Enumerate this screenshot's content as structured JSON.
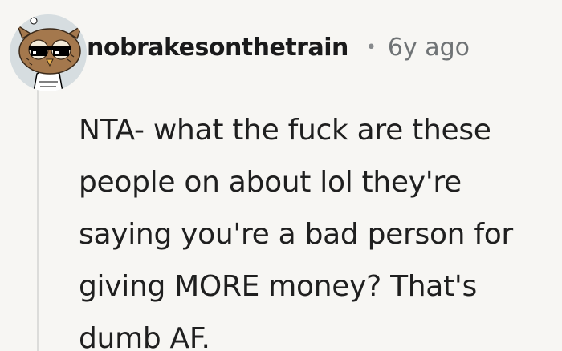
{
  "comment": {
    "username": "nobrakesonthetrain",
    "separator": "•",
    "age": "6y ago",
    "body_lines": [
      "NTA- what the fuck are these",
      "people on about lol they're",
      "saying you're a bad person for",
      "giving MORE money? That's",
      "dumb AF."
    ],
    "avatar_icon": "owl-avatar-with-sunglasses-icon"
  }
}
